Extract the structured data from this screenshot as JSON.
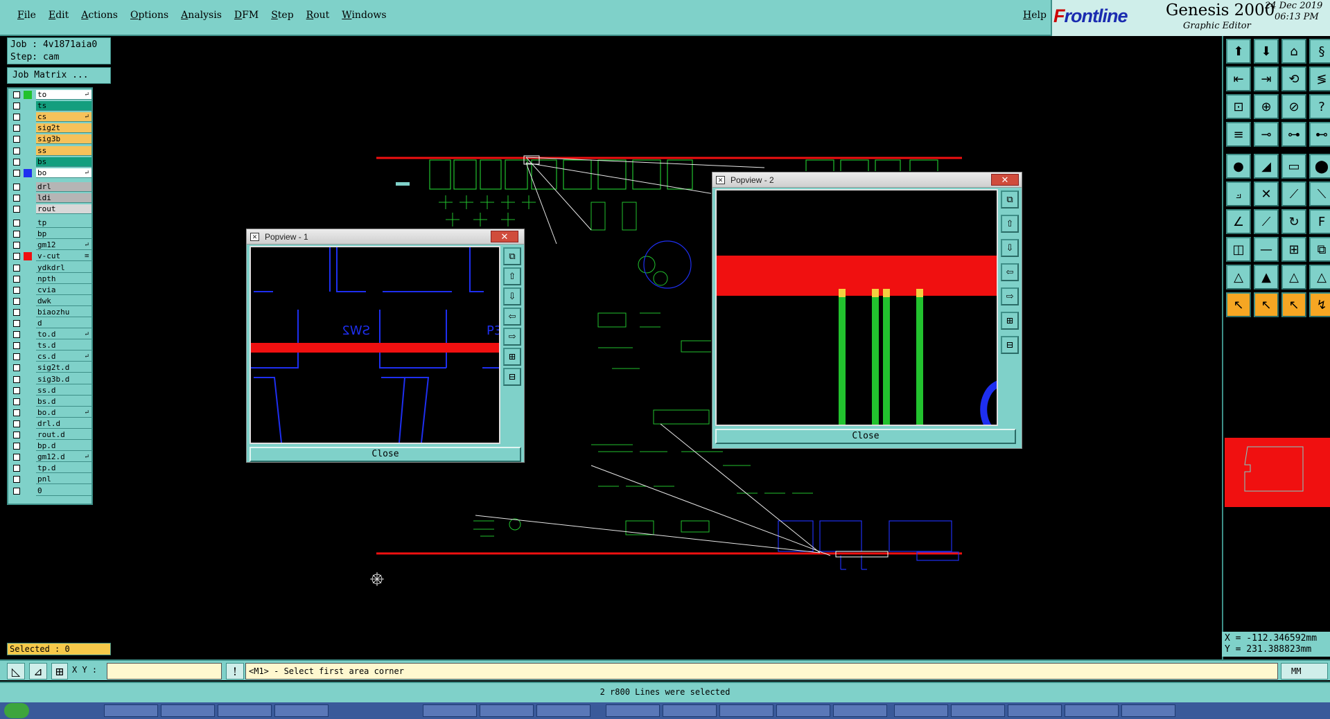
{
  "menu": {
    "items": [
      "File",
      "Edit",
      "Actions",
      "Options",
      "Analysis",
      "DFM",
      "Step",
      "Rout",
      "Windows"
    ],
    "help": "Help"
  },
  "brand": {
    "frontline_f": "F",
    "frontline_rest": "rontline",
    "product": "Genesis 2000",
    "subtitle": "Graphic Editor",
    "date": "24 Dec 2019",
    "time": "06:13 PM"
  },
  "job": {
    "job_line": "Job : 4v1871aia0",
    "step_line": "Step: cam",
    "matrix_button": "Job Matrix ..."
  },
  "layers": [
    {
      "name": "to",
      "color": "#22c22e",
      "bg": "#ffffff",
      "mark": "↵"
    },
    {
      "name": "ts",
      "color": "#7fd1c9",
      "bg": "#139e7e",
      "mark": ""
    },
    {
      "name": "cs",
      "color": "#7fd1c9",
      "bg": "#f6c25a",
      "mark": "↵"
    },
    {
      "name": "sig2t",
      "color": "#7fd1c9",
      "bg": "#f6c25a",
      "mark": ""
    },
    {
      "name": "sig3b",
      "color": "#7fd1c9",
      "bg": "#f6c25a",
      "mark": ""
    },
    {
      "name": "ss",
      "color": "#7fd1c9",
      "bg": "#f6c25a",
      "mark": ""
    },
    {
      "name": "bs",
      "color": "#7fd1c9",
      "bg": "#139e7e",
      "mark": ""
    },
    {
      "name": "bo",
      "color": "#1e2ff0",
      "bg": "#ffffff",
      "mark": "↵"
    },
    {
      "name": "drl",
      "color": "#7fd1c9",
      "bg": "#b5b5b5",
      "mark": ""
    },
    {
      "name": "ldi",
      "color": "#7fd1c9",
      "bg": "#b5b5b5",
      "mark": ""
    },
    {
      "name": "rout",
      "color": "#7fd1c9",
      "bg": "#d8d8d8",
      "mark": ""
    },
    {
      "name": "tp",
      "color": "#7fd1c9",
      "bg": "#7fd1c9",
      "mark": ""
    },
    {
      "name": "bp",
      "color": "#7fd1c9",
      "bg": "#7fd1c9",
      "mark": ""
    },
    {
      "name": "gm12",
      "color": "#7fd1c9",
      "bg": "#7fd1c9",
      "mark": "↵"
    },
    {
      "name": "v-cut",
      "color": "#f01010",
      "bg": "#7fd1c9",
      "mark": "≡"
    },
    {
      "name": "ydkdrl",
      "color": "#7fd1c9",
      "bg": "#7fd1c9",
      "mark": ""
    },
    {
      "name": "npth",
      "color": "#7fd1c9",
      "bg": "#7fd1c9",
      "mark": ""
    },
    {
      "name": "cvia",
      "color": "#7fd1c9",
      "bg": "#7fd1c9",
      "mark": ""
    },
    {
      "name": "dwk",
      "color": "#7fd1c9",
      "bg": "#7fd1c9",
      "mark": ""
    },
    {
      "name": "biaozhu",
      "color": "#7fd1c9",
      "bg": "#7fd1c9",
      "mark": ""
    },
    {
      "name": "d",
      "color": "#7fd1c9",
      "bg": "#7fd1c9",
      "mark": ""
    },
    {
      "name": "to.d",
      "color": "#7fd1c9",
      "bg": "#7fd1c9",
      "mark": "↵"
    },
    {
      "name": "ts.d",
      "color": "#7fd1c9",
      "bg": "#7fd1c9",
      "mark": ""
    },
    {
      "name": "cs.d",
      "color": "#7fd1c9",
      "bg": "#7fd1c9",
      "mark": "↵"
    },
    {
      "name": "sig2t.d",
      "color": "#7fd1c9",
      "bg": "#7fd1c9",
      "mark": ""
    },
    {
      "name": "sig3b.d",
      "color": "#7fd1c9",
      "bg": "#7fd1c9",
      "mark": ""
    },
    {
      "name": "ss.d",
      "color": "#7fd1c9",
      "bg": "#7fd1c9",
      "mark": ""
    },
    {
      "name": "bs.d",
      "color": "#7fd1c9",
      "bg": "#7fd1c9",
      "mark": ""
    },
    {
      "name": "bo.d",
      "color": "#7fd1c9",
      "bg": "#7fd1c9",
      "mark": "↵"
    },
    {
      "name": "drl.d",
      "color": "#7fd1c9",
      "bg": "#7fd1c9",
      "mark": ""
    },
    {
      "name": "rout.d",
      "color": "#7fd1c9",
      "bg": "#7fd1c9",
      "mark": ""
    },
    {
      "name": "bp.d",
      "color": "#7fd1c9",
      "bg": "#7fd1c9",
      "mark": ""
    },
    {
      "name": "gm12.d",
      "color": "#7fd1c9",
      "bg": "#7fd1c9",
      "mark": "↵"
    },
    {
      "name": "tp.d",
      "color": "#7fd1c9",
      "bg": "#7fd1c9",
      "mark": ""
    },
    {
      "name": "pnl",
      "color": "#7fd1c9",
      "bg": "#7fd1c9",
      "mark": ""
    },
    {
      "name": "0",
      "color": "#7fd1c9",
      "bg": "#7fd1c9",
      "mark": ""
    }
  ],
  "selected": "Selected : 0",
  "popview1": {
    "title": "Popview - 1",
    "close_label": "Close",
    "silk_text": "SW2",
    "silk_text2": "P3"
  },
  "popview2": {
    "title": "Popview - 2",
    "close_label": "Close"
  },
  "coords": {
    "x_line": "X = -112.346592mm",
    "y_line": "Y = 231.388823mm"
  },
  "bottom": {
    "xy_label": "X Y :",
    "xy_value": "",
    "message": "<M1> - Select first area corner",
    "units": "MM"
  },
  "status": "2 r800 Lines were selected",
  "colors": {
    "panel": "#7fd1c9",
    "vcut": "#f01010",
    "top": "#22c22e",
    "bottom": "#1e2ff0"
  }
}
